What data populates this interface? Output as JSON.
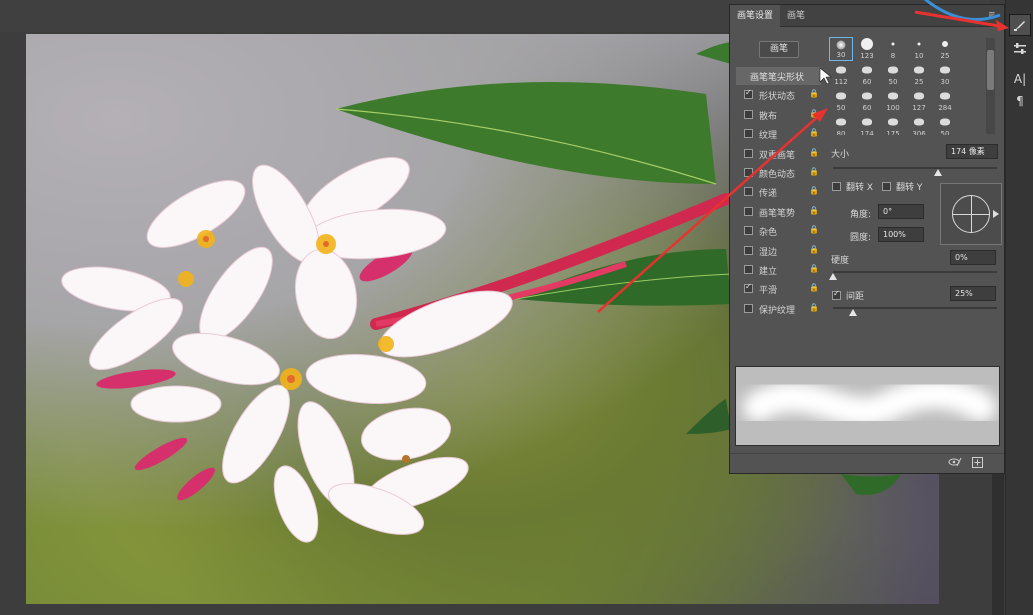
{
  "panel": {
    "tabs": [
      {
        "label": "画笔设置"
      },
      {
        "label": "画笔"
      }
    ],
    "brush_button": "画笔",
    "options": [
      {
        "label": "画笔笔尖形状",
        "header": true
      },
      {
        "label": "形状动态",
        "checked": true
      },
      {
        "label": "散布",
        "checked": false
      },
      {
        "label": "纹理",
        "checked": false
      },
      {
        "label": "双重画笔",
        "checked": false
      },
      {
        "label": "颜色动态",
        "checked": false
      },
      {
        "label": "传递",
        "checked": false
      },
      {
        "label": "画笔笔势",
        "checked": false
      },
      {
        "label": "杂色",
        "checked": false
      },
      {
        "label": "湿边",
        "checked": false
      },
      {
        "label": "建立",
        "checked": false
      },
      {
        "label": "平滑",
        "checked": true
      },
      {
        "label": "保护纹理",
        "checked": false
      }
    ],
    "presets": [
      "30",
      "123",
      "8",
      "10",
      "25",
      "112",
      "60",
      "50",
      "25",
      "30",
      "50",
      "60",
      "100",
      "127",
      "284",
      "80",
      "174",
      "175",
      "306",
      "50"
    ],
    "size_label": "大小",
    "size_value": "174 像素",
    "flip_x": "翻转 X",
    "flip_y": "翻转 Y",
    "angle_label": "角度:",
    "angle_value": "0°",
    "roundness_label": "圆度:",
    "roundness_value": "100%",
    "hardness_label": "硬度",
    "hardness_value": "0%",
    "spacing_label": "间距",
    "spacing_value": "25%",
    "spacing_checked": true
  },
  "sliders": {
    "size": 0.64,
    "hardness": 0.0,
    "spacing": 0.12
  },
  "colors": {
    "panel_bg": "#535353",
    "arrow": "#e8322f",
    "circle_annotation": "#3a8fd6"
  },
  "icons": [
    "brush-settings-icon",
    "adjust-icon",
    "character-icon",
    "paragraph-icon",
    "eye-preview-icon",
    "new-brush-icon",
    "panel-menu-icon"
  ]
}
